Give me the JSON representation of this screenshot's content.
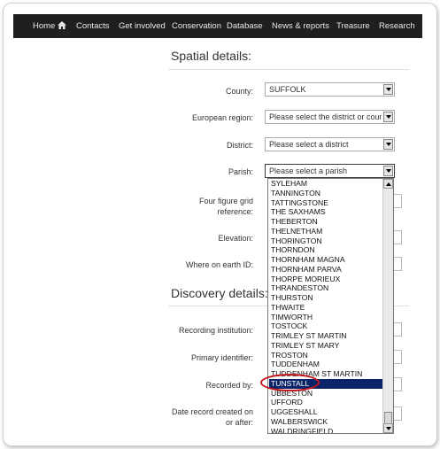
{
  "nav": {
    "items": [
      "Home",
      "Contacts",
      "Get involved",
      "Conservation",
      "Database",
      "News & reports",
      "Treasure",
      "Research"
    ]
  },
  "spatial": {
    "title": "Spatial details:",
    "county_label": "County:",
    "county_value": "SUFFOLK",
    "region_label": "European region:",
    "region_value": "Please select the district or county",
    "district_label": "District:",
    "district_value": "Please select a district",
    "parish_label": "Parish:",
    "parish_value": "Please select a parish",
    "grid_label_1": "Four figure grid",
    "grid_label_2": "reference:",
    "elevation_label": "Elevation:",
    "where_label": "Where on earth ID:"
  },
  "discovery": {
    "title": "Discovery details:",
    "institution_label": "Recording institution:",
    "identifier_label": "Primary identifier:",
    "recorded_label": "Recorded by:",
    "date_label_1": "Date record created on",
    "date_label_2": "or after:"
  },
  "dropdown": {
    "options": [
      "SYLEHAM",
      "TANNINGTON",
      "TATTINGSTONE",
      "THE SAXHAMS",
      "THEBERTON",
      "THELNETHAM",
      "THORINGTON",
      "THORNDON",
      "THORNHAM MAGNA",
      "THORNHAM PARVA",
      "THORPE MORIEUX",
      "THRANDESTON",
      "THURSTON",
      "THWAITE",
      "TIMWORTH",
      "TOSTOCK",
      "TRIMLEY ST MARTIN",
      "TRIMLEY ST MARY",
      "TROSTON",
      "TUDDENHAM",
      "TUDDENHAM ST MARTIN",
      "TUNSTALL",
      "UBBESTON",
      "UFFORD",
      "UGGESHALL",
      "WALBERSWICK",
      "WALDRINGFIELD"
    ],
    "selected": "TUNSTALL"
  },
  "colors": {
    "nav_bg": "#1f1f1f",
    "highlight": "#0a246a",
    "annotation": "#c4161c"
  }
}
